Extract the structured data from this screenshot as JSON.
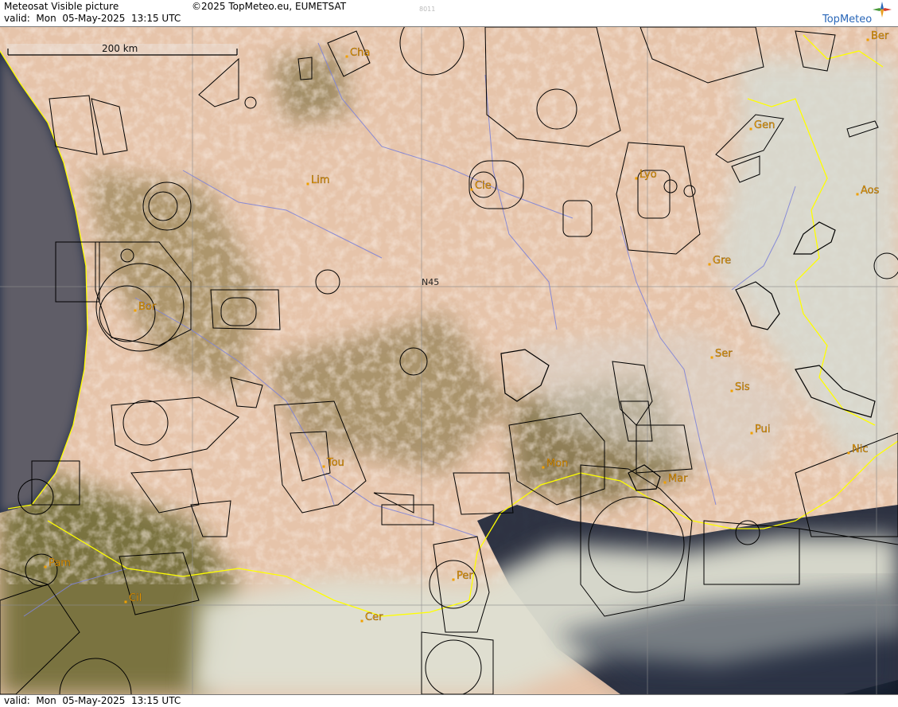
{
  "header": {
    "title": "Meteosat Visible picture",
    "valid": "valid:  Mon  05-May-2025  13:15 UTC",
    "copyright": "©2025 TopMeteo.eu, EUMETSAT",
    "image_code": "8011",
    "logo": "TopMeteo"
  },
  "footer": {
    "valid": "valid:  Mon  05-May-2025  13:15 UTC"
  },
  "scale_bar": {
    "label": "200 km"
  },
  "grid_label": "N45",
  "colors": {
    "ocean": "#1e2c46",
    "land_cloud": "#e8c9b2",
    "vegetation": "#74693a",
    "coast": "#ffff00",
    "airspace": "#000000",
    "rivers": "#7f84d8",
    "city": "#f0a000",
    "grid": "#8c8c8c",
    "logo": "#2a67b8"
  },
  "cities": [
    {
      "label": "Cha"
    },
    {
      "label": "Ber"
    },
    {
      "label": "Gen"
    },
    {
      "label": "Lim"
    },
    {
      "label": "Cle"
    },
    {
      "label": "Lyo"
    },
    {
      "label": "Aos"
    },
    {
      "label": "Gre"
    },
    {
      "label": "Bor"
    },
    {
      "label": "Ser"
    },
    {
      "label": "Sis"
    },
    {
      "label": "Pui"
    },
    {
      "label": "Tou"
    },
    {
      "label": "Mon"
    },
    {
      "label": "Mar"
    },
    {
      "label": "Nic"
    },
    {
      "label": "Pam"
    },
    {
      "label": "Per"
    },
    {
      "label": "Cil"
    },
    {
      "label": "Cer"
    }
  ]
}
